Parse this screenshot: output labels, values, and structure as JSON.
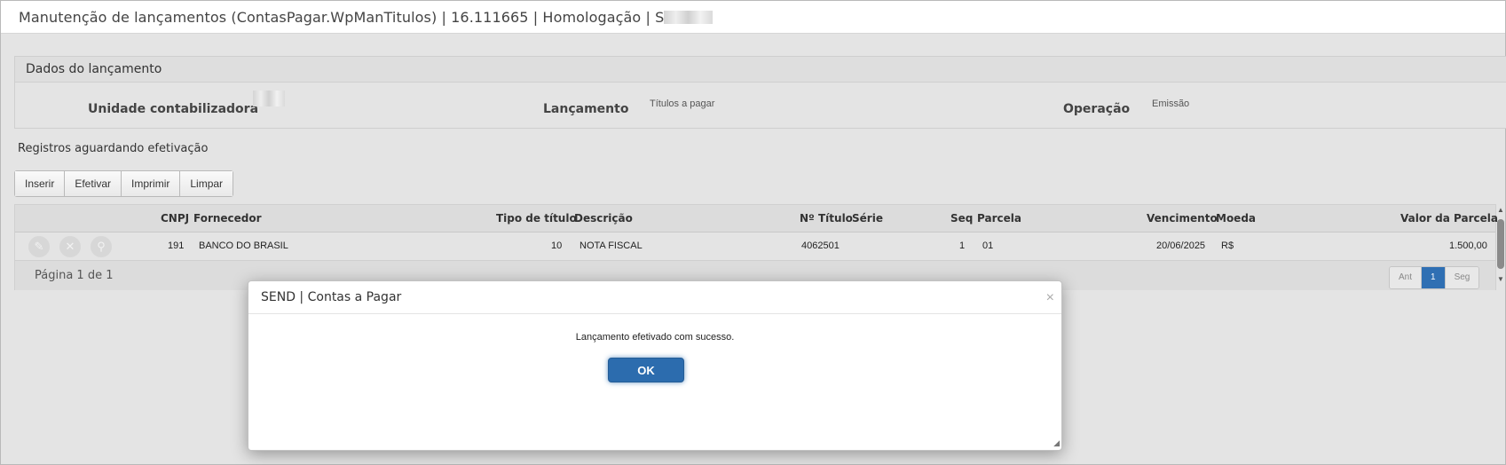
{
  "window": {
    "title": "Manutenção de lançamentos (ContasPagar.WpManTitulos) | 16.111665 | Homologação | S"
  },
  "panel": {
    "header": "Dados do lançamento",
    "unidade_label": "Unidade contabilizadora",
    "lancamento_label": "Lançamento",
    "lancamento_value": "Títulos a pagar",
    "operacao_label": "Operação",
    "operacao_value": "Emissão"
  },
  "section_title": "Registros aguardando efetivação",
  "toolbar": {
    "inserir": "Inserir",
    "efetivar": "Efetivar",
    "imprimir": "Imprimir",
    "limpar": "Limpar"
  },
  "grid": {
    "columns": {
      "cnpj": "CNPJ",
      "fornecedor": "Fornecedor",
      "tipo": "Tipo de título",
      "descricao": "Descrição",
      "titulo": "Nº Título",
      "serie": "Série",
      "seq": "Seq",
      "parcela": "Parcela",
      "vencimento": "Vencimento",
      "moeda": "Moeda",
      "valor": "Valor da Parcela"
    },
    "rows": [
      {
        "cnpj": "191",
        "fornecedor": "BANCO DO BRASIL",
        "tipo": "10",
        "descricao": "NOTA FISCAL",
        "titulo": "4062501",
        "serie": "",
        "seq": "1",
        "parcela": "01",
        "vencimento": "20/06/2025",
        "moeda": "R$",
        "valor": "1.500,00"
      }
    ],
    "row_icons": [
      "pencil-icon",
      "close-icon",
      "search-icon"
    ],
    "page_info": "Página 1 de 1",
    "pager": {
      "prev": "Ant",
      "current": "1",
      "next": "Seg"
    }
  },
  "modal": {
    "title": "SEND | Contas a Pagar",
    "close": "×",
    "message": "Lançamento efetivado com sucesso.",
    "ok": "OK"
  },
  "colors": {
    "accent": "#2c6cae",
    "background": "#e4e4e4"
  }
}
